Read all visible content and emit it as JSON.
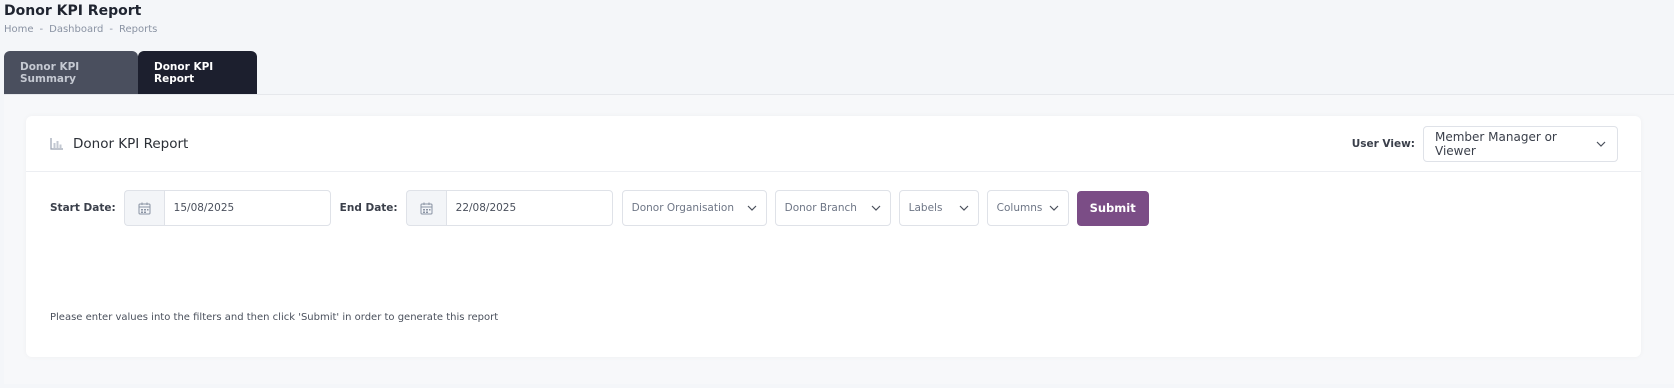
{
  "page": {
    "title": "Donor KPI Report",
    "breadcrumb": [
      "Home",
      "Dashboard",
      "Reports"
    ],
    "breadcrumb_separator": "-"
  },
  "tabs": [
    {
      "label": "Donor KPI Summary",
      "active": false
    },
    {
      "label": "Donor KPI Report",
      "active": true
    }
  ],
  "card": {
    "title": "Donor KPI Report",
    "icon": "bar-chart-icon",
    "user_view_label": "User View:",
    "user_view_value": "Member Manager or Viewer"
  },
  "filters": {
    "start_date_label": "Start Date:",
    "start_date_value": "15/08/2025",
    "end_date_label": "End Date:",
    "end_date_value": "22/08/2025",
    "donor_organisation_placeholder": "Donor Organisation",
    "donor_branch_placeholder": "Donor Branch",
    "labels_placeholder": "Labels",
    "columns_placeholder": "Columns",
    "submit_label": "Submit"
  },
  "message": "Please enter values into the filters and then click 'Submit' in order to generate this report",
  "colors": {
    "submit": "#7b4d86",
    "tab_active": "#1c1f2e",
    "tab_inactive": "#4a4f5e"
  }
}
